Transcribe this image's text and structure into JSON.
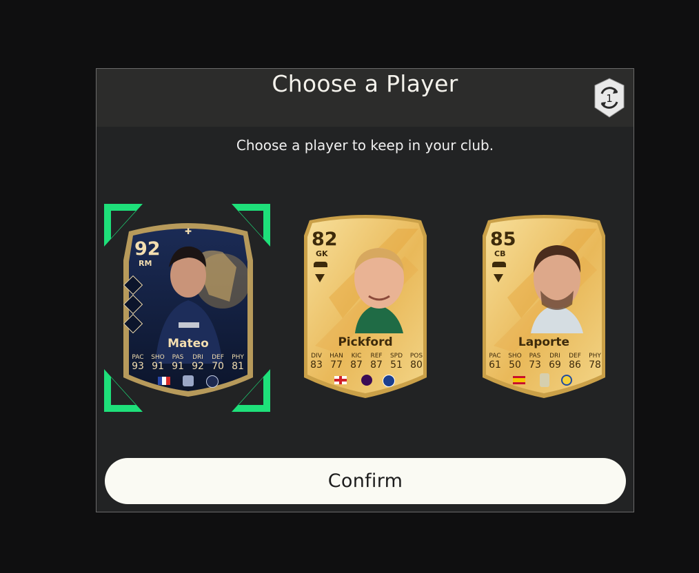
{
  "modal": {
    "title": "Choose a Player",
    "subtitle": "Choose a player to keep in your club.",
    "swap_badge_count": "1",
    "confirm_label": "Confirm"
  },
  "cards": [
    {
      "name": "Mateo",
      "rating": "92",
      "position": "RM",
      "style": "toty",
      "selected": true,
      "stat_labels": [
        "PAC",
        "SHO",
        "PAS",
        "DRI",
        "DEF",
        "PHY"
      ],
      "stat_values": [
        "93",
        "91",
        "91",
        "92",
        "70",
        "81"
      ],
      "nation_icon": "france-flag-icon",
      "league_icon": "arkema-league-icon",
      "club_icon": "paris-fc-crest-icon"
    },
    {
      "name": "Pickford",
      "rating": "82",
      "position": "GK",
      "style": "gold",
      "selected": false,
      "stat_labels": [
        "DIV",
        "HAN",
        "KIC",
        "REF",
        "SPD",
        "POS"
      ],
      "stat_values": [
        "83",
        "77",
        "87",
        "87",
        "51",
        "80"
      ],
      "nation_icon": "england-flag-icon",
      "league_icon": "premier-league-icon",
      "club_icon": "everton-crest-icon"
    },
    {
      "name": "Laporte",
      "rating": "85",
      "position": "CB",
      "style": "gold",
      "selected": false,
      "stat_labels": [
        "PAC",
        "SHO",
        "PAS",
        "DRI",
        "DEF",
        "PHY"
      ],
      "stat_values": [
        "61",
        "50",
        "73",
        "69",
        "86",
        "78"
      ],
      "nation_icon": "spain-flag-icon",
      "league_icon": "saudi-pro-league-icon",
      "club_icon": "al-nassr-crest-icon"
    }
  ],
  "colors": {
    "selection_green": "#1ee07a",
    "gold_light": "#f6d98a",
    "gold_dark": "#d9a63a",
    "toty_navy": "#13203f"
  }
}
